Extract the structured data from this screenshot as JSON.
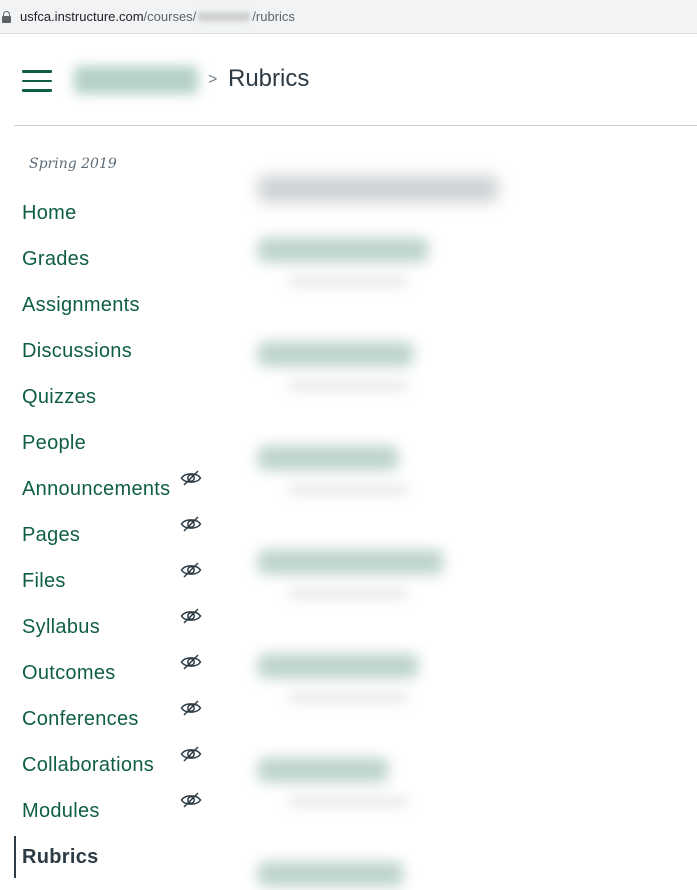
{
  "browser": {
    "url_host": "usfca.instructure.com",
    "url_path_prefix": "/courses/",
    "url_path_suffix": "/rubrics"
  },
  "header": {
    "menu_icon": "hamburger-menu-icon",
    "breadcrumb_separator": ">",
    "page_title": "Rubrics"
  },
  "sidebar": {
    "term": "Spring 2019",
    "items": [
      {
        "label": "Home",
        "hidden_from_students": false
      },
      {
        "label": "Grades",
        "hidden_from_students": false
      },
      {
        "label": "Assignments",
        "hidden_from_students": false
      },
      {
        "label": "Discussions",
        "hidden_from_students": false
      },
      {
        "label": "Quizzes",
        "hidden_from_students": false
      },
      {
        "label": "People",
        "hidden_from_students": false
      },
      {
        "label": "Announcements",
        "hidden_from_students": true
      },
      {
        "label": "Pages",
        "hidden_from_students": true
      },
      {
        "label": "Files",
        "hidden_from_students": true
      },
      {
        "label": "Syllabus",
        "hidden_from_students": true
      },
      {
        "label": "Outcomes",
        "hidden_from_students": true
      },
      {
        "label": "Conferences",
        "hidden_from_students": true
      },
      {
        "label": "Collaborations",
        "hidden_from_students": true
      },
      {
        "label": "Modules",
        "hidden_from_students": true
      },
      {
        "label": "Rubrics",
        "hidden_from_students": false,
        "active": true
      }
    ],
    "hidden_icon": "eye-slash-icon"
  },
  "colors": {
    "link": "#0e5e46",
    "text": "#2d3b45",
    "muted": "#5b6b77",
    "divider": "#c7cdd1"
  }
}
